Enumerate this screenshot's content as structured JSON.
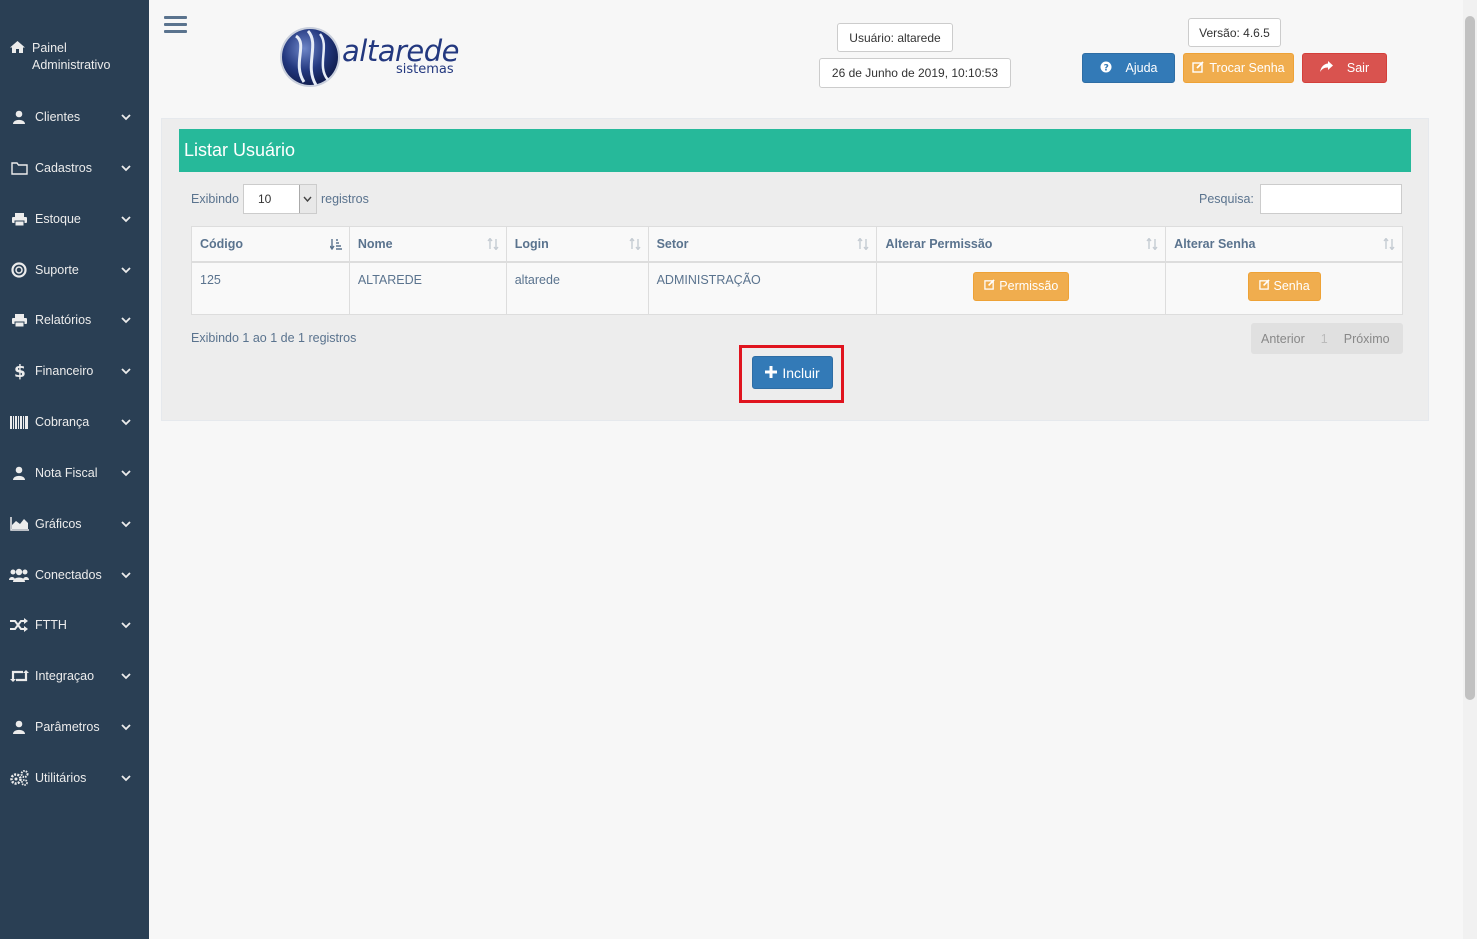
{
  "colors": {
    "sidebar": "#2a3f54",
    "accent": "#26b99a",
    "primary": "#337ab7",
    "warning": "#f0ad4e",
    "danger": "#d9534f",
    "highlight": "#e0141e"
  },
  "sidebar": {
    "brand": "Painel Administrativo",
    "items": [
      {
        "label": "Clientes",
        "icon": "user-icon"
      },
      {
        "label": "Cadastros",
        "icon": "folder-icon"
      },
      {
        "label": "Estoque",
        "icon": "printer-icon"
      },
      {
        "label": "Suporte",
        "icon": "lifebuoy-icon"
      },
      {
        "label": "Relatórios",
        "icon": "printer-icon"
      },
      {
        "label": "Financeiro",
        "icon": "dollar-icon"
      },
      {
        "label": "Cobrança",
        "icon": "barcode-icon"
      },
      {
        "label": "Nota Fiscal",
        "icon": "user-icon"
      },
      {
        "label": "Gráficos",
        "icon": "area-chart-icon"
      },
      {
        "label": "Conectados",
        "icon": "users-icon"
      },
      {
        "label": "FTTH",
        "icon": "random-icon"
      },
      {
        "label": "Integraçao",
        "icon": "retweet-icon"
      },
      {
        "label": "Parâmetros",
        "icon": "user-icon"
      },
      {
        "label": "Utilitários",
        "icon": "cogs-icon"
      }
    ]
  },
  "header": {
    "logo_main": "altarede",
    "logo_sub": "sistemas",
    "user": "Usuário: altarede",
    "datetime": "26 de Junho de 2019, 10:10:53",
    "version": "Versão: 4.6.5",
    "help": "Ajuda",
    "change_password": "Trocar Senha",
    "logout": "Sair"
  },
  "panel": {
    "title": "Listar Usuário",
    "show_prefix": "Exibindo",
    "page_size": "10",
    "show_suffix": "registros",
    "search_label": "Pesquisa:",
    "search_value": "",
    "columns": [
      "Código",
      "Nome",
      "Login",
      "Setor",
      "Alterar Permissão",
      "Alterar Senha"
    ],
    "rows": [
      {
        "codigo": "125",
        "nome": "ALTAREDE",
        "login": "altarede",
        "setor": "ADMINISTRAÇÃO",
        "perm_btn": "Permissão",
        "senha_btn": "Senha"
      }
    ],
    "info": "Exibindo 1 ao 1 de 1 registros",
    "pager": {
      "prev": "Anterior",
      "page": "1",
      "next": "Próximo"
    },
    "add_button": "Incluir"
  }
}
